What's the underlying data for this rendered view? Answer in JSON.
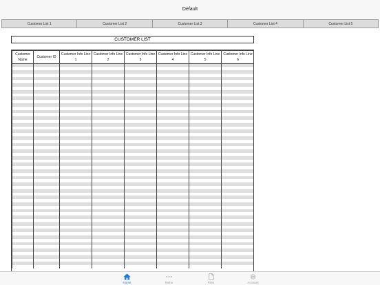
{
  "nav": {
    "title": "Default"
  },
  "tabs": [
    {
      "label": "Customer List 1"
    },
    {
      "label": "Customer List 2"
    },
    {
      "label": "Customer List 3"
    },
    {
      "label": "Customer List 4"
    },
    {
      "label": "Customer List 5"
    }
  ],
  "sheet": {
    "title": "CUSTOMER LIST",
    "columns": [
      "Customer Name",
      "Customer ID",
      "Customer Info Line 1",
      "Customer Info Line 2",
      "Customer Info Line 3",
      "Customer Info Line 4",
      "Customer Info Line 5",
      "Customer Info Line 6"
    ]
  },
  "tabbar": {
    "items": [
      {
        "label": "Home",
        "icon": "home-icon",
        "active": true
      },
      {
        "label": "Menu",
        "icon": "more-icon",
        "active": false
      },
      {
        "label": "Files",
        "icon": "file-icon",
        "active": false
      },
      {
        "label": "Account",
        "icon": "gear-icon",
        "active": false
      }
    ],
    "active_color": "#1f7ae0",
    "inactive_color": "#9a9a9a"
  }
}
